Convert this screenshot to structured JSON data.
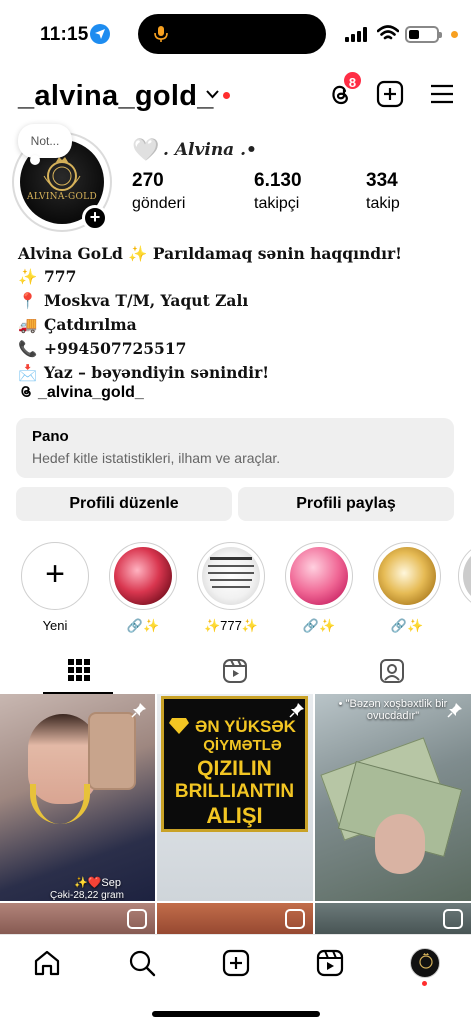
{
  "status": {
    "time": "11:15",
    "battery_level": 0.4
  },
  "header": {
    "username": "_alvina_gold_",
    "threads_badge": "8"
  },
  "profile": {
    "note": "Not...",
    "avatar_text": "ALVINA-GOLD",
    "full_name": ". Alvina .•",
    "stats": [
      {
        "value": "270",
        "label": "gönderi"
      },
      {
        "value": "6.130",
        "label": "takipçi"
      },
      {
        "value": "334",
        "label": "takip"
      }
    ],
    "bio": [
      {
        "emoji": "",
        "text": "Alvina GoLd ✨ Parıldamaq sənin haqqındır!"
      },
      {
        "emoji": "✨",
        "text": "777"
      },
      {
        "emoji": "📍",
        "text": "Moskva T/M, Yaqut Zalı"
      },
      {
        "emoji": "🚚",
        "text": "Çatdırılma"
      },
      {
        "emoji": "📞",
        "text": "+994507725517"
      },
      {
        "emoji": "📩",
        "text": "Yaz – bəyəndiyin sənindir!"
      }
    ],
    "threads_handle": "_alvina_gold_"
  },
  "pano": {
    "title": "Pano",
    "subtitle": "Hedef kitle istatistikleri, ilham ve araçlar."
  },
  "buttons": {
    "edit": "Profili düzenle",
    "share": "Profili paylaş"
  },
  "highlights": [
    {
      "label": "Yeni"
    },
    {
      "label": "🔗✨"
    },
    {
      "label": "✨777✨"
    },
    {
      "label": "🔗✨"
    },
    {
      "label": "🔗✨"
    }
  ],
  "grid": {
    "post1_caption_top": "✨❤️Sep",
    "post1_caption_bottom": "Çəki-28,22 gram",
    "post2_lines": [
      "ƏN YÜKSƏK",
      "QİYMƏTLƏ",
      "QIZILIN",
      "BRILLIANTIN",
      "ALIŞI"
    ],
    "post3_caption": "• \"Bəzən xoşbəxtlik bir ovucdadır\""
  },
  "colors": {
    "accent_red": "#ff2d45",
    "gold": "#d6b25a",
    "button_bg": "#efefef"
  }
}
